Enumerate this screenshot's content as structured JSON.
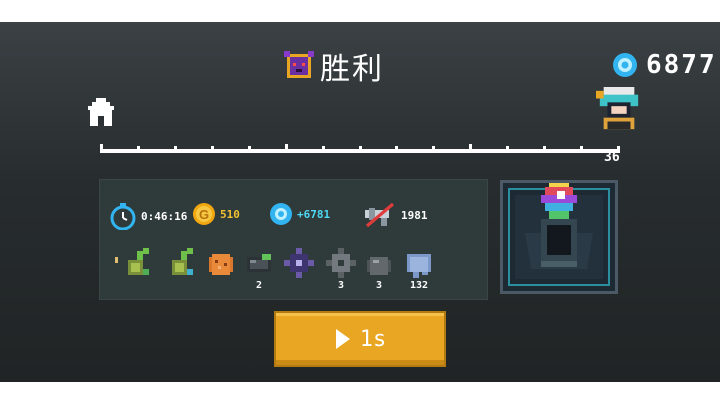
{
  "header": {
    "title": "胜利",
    "title_icon": "demon-mask-icon",
    "gems_total": "6877"
  },
  "progress": {
    "start_icon": "home-icon",
    "end_icon": "boss-portrait-icon",
    "level": "36"
  },
  "stats": {
    "time": "0:46:16",
    "gold": "510",
    "gems_gained": "+6781",
    "kills": "1981"
  },
  "items": [
    {
      "icon": "seed-dot-icon",
      "count": ""
    },
    {
      "icon": "seedling-icon",
      "count": ""
    },
    {
      "icon": "seedling-icon",
      "count": ""
    },
    {
      "icon": "ore-chunk-icon",
      "count": ""
    },
    {
      "icon": "battery-cell-icon",
      "count": "2"
    },
    {
      "icon": "dark-shard-icon",
      "count": ""
    },
    {
      "icon": "gear-icon",
      "count": "3"
    },
    {
      "icon": "stone-icon",
      "count": "3"
    },
    {
      "icon": "cloth-icon",
      "count": "132"
    }
  ],
  "relic": {
    "icon": "rainbow-crystal-icon"
  },
  "play_button": {
    "label": "1s",
    "icon": "play-icon"
  },
  "colors": {
    "panel": "#2f3a3a",
    "button": "#e8a623",
    "gem": "#32b4f0",
    "gold": "#f1c232"
  }
}
